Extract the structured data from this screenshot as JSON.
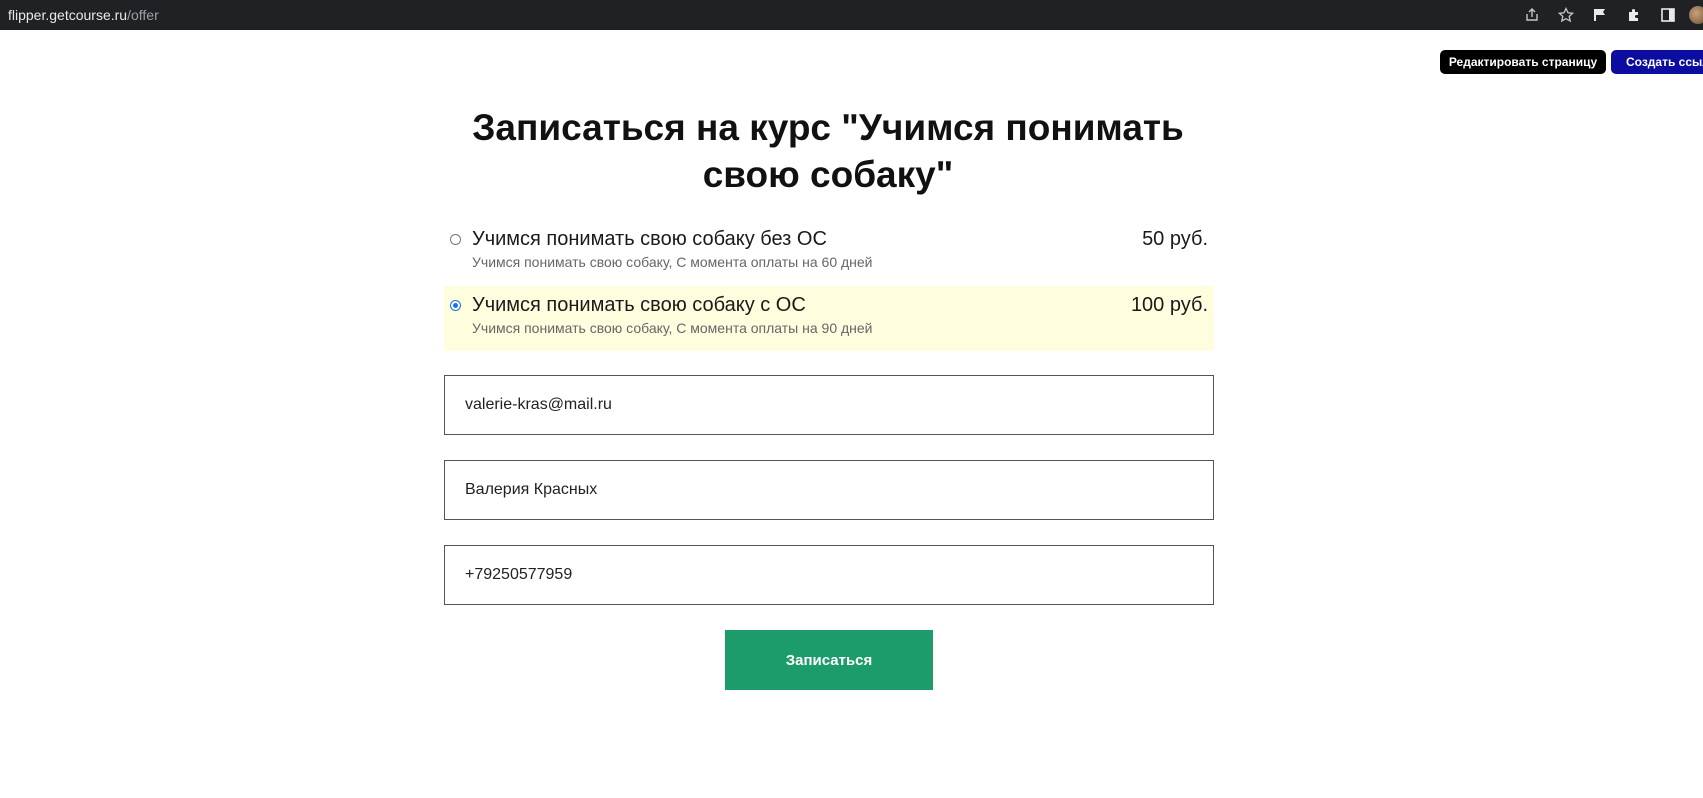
{
  "browser": {
    "url_host": "flipper.getcourse.ru",
    "url_path": "/offer"
  },
  "admin": {
    "edit_label": "Редактировать страницу",
    "create_label": "Создать ссылку"
  },
  "form": {
    "title": "Записаться на курс \"Учимся понимать свою собаку\"",
    "offers": [
      {
        "name": "Учимся понимать свою собаку без ОС",
        "price": "50 руб.",
        "description": "Учимся понимать свою собаку, С момента оплаты на 60 дней",
        "selected": false
      },
      {
        "name": "Учимся понимать свою собаку с ОС",
        "price": "100 руб.",
        "description": "Учимся понимать свою собаку, С момента оплаты на 90 дней",
        "selected": true
      }
    ],
    "email": "valerie-kras@mail.ru",
    "name": "Валерия Красных",
    "phone": "+79250577959",
    "submit_label": "Записаться"
  },
  "colors": {
    "submit_bg": "#1b9c6a",
    "selected_offer_bg": "#fefedf",
    "edit_btn_bg": "#000000",
    "create_btn_bg": "#0c0ca0"
  }
}
